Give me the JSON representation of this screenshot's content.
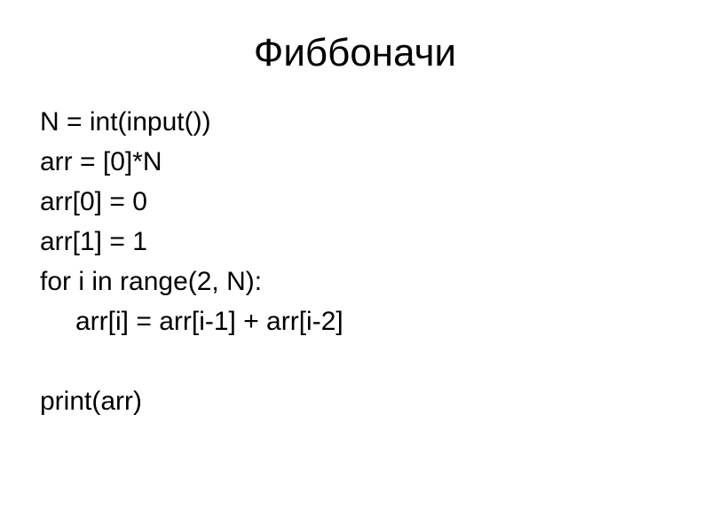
{
  "slide": {
    "title": "Фиббоначи",
    "code": {
      "line1": "N = int(input())",
      "line2": "arr = [0]*N",
      "line3": "arr[0] = 0",
      "line4": "arr[1] = 1",
      "line5": "for i in range(2, N):",
      "line6": "arr[i] = arr[i-1] + arr[i-2]",
      "line7": "print(arr)"
    }
  }
}
